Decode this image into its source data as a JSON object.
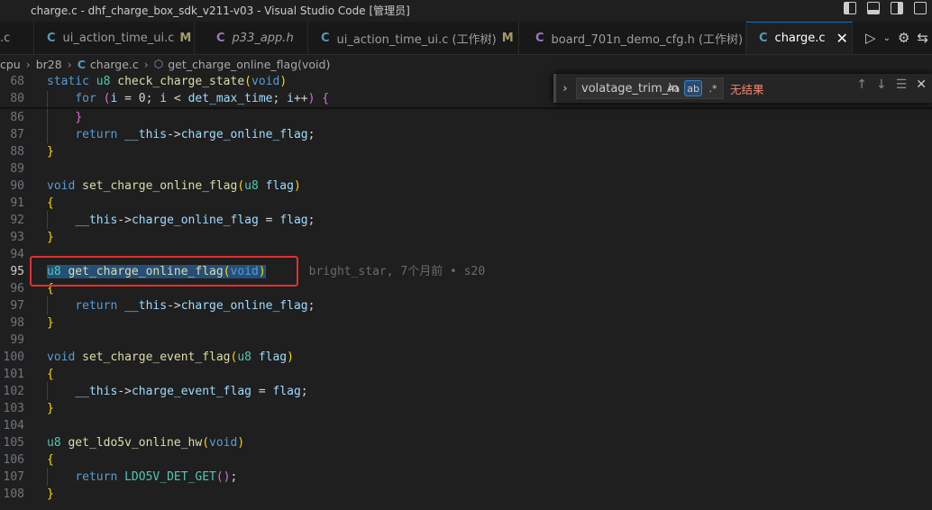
{
  "window": {
    "title": "charge.c - dhf_charge_box_sdk_v211-v03 - Visual Studio Code [管理员]"
  },
  "tabs": [
    {
      "label": ".c",
      "icon": "c-file-icon",
      "modified": "",
      "active": false,
      "italic": false
    },
    {
      "label": "ui_action_time_ui.c",
      "icon": "c-file-icon",
      "modified": "M",
      "active": false,
      "italic": false
    },
    {
      "label": "p33_app.h",
      "icon": "h-file-icon",
      "modified": "",
      "active": false,
      "italic": true
    },
    {
      "label": "ui_action_time_ui.c (工作树)",
      "icon": "c-file-icon",
      "modified": "M",
      "active": false,
      "italic": false
    },
    {
      "label": "board_701n_demo_cfg.h (工作树)",
      "icon": "h-file-icon",
      "modified": "",
      "active": false,
      "italic": false
    },
    {
      "label": "charge.c",
      "icon": "c-file-icon",
      "modified": "",
      "active": true,
      "italic": false
    }
  ],
  "tab_icons": {
    "c": "C",
    "h": "C"
  },
  "breadcrumb": {
    "segments": [
      "cpu",
      "br28",
      "charge.c",
      "get_charge_online_flag(void)"
    ]
  },
  "find": {
    "query": "volatage_trim_in",
    "match_case": "Aa",
    "whole_word": "ab",
    "regex": ".*",
    "result": "无结果"
  },
  "blame": "bright_star, 7个月前 • s20",
  "lines": [
    {
      "num": "68",
      "tokens": [
        [
          "kw",
          "static "
        ],
        [
          "ty",
          "u8 "
        ],
        [
          "fn",
          "check_charge_state"
        ],
        [
          "br1",
          "("
        ],
        [
          "kw",
          "void"
        ],
        [
          "br1",
          ")"
        ]
      ]
    },
    {
      "num": "80",
      "tokens": [
        [
          "plain",
          "    "
        ],
        [
          "kw",
          "for "
        ],
        [
          "br2",
          "("
        ],
        [
          "var",
          "i"
        ],
        [
          "op",
          " = "
        ],
        [
          "plain",
          "0; "
        ],
        [
          "var",
          "i"
        ],
        [
          "op",
          " < "
        ],
        [
          "var",
          "det_max_time"
        ],
        [
          "plain",
          "; "
        ],
        [
          "var",
          "i"
        ],
        [
          "op",
          "++"
        ],
        [
          "br2",
          ")"
        ],
        [
          "plain",
          " "
        ],
        [
          "br2",
          "{"
        ]
      ]
    },
    {
      "num": "86",
      "tokens": [
        [
          "plain",
          "    "
        ],
        [
          "br2",
          "}"
        ]
      ]
    },
    {
      "num": "87",
      "tokens": [
        [
          "plain",
          "    "
        ],
        [
          "kw",
          "return "
        ],
        [
          "var",
          "__this"
        ],
        [
          "op",
          "->"
        ],
        [
          "var",
          "charge_online_flag"
        ],
        [
          "plain",
          ";"
        ]
      ]
    },
    {
      "num": "88",
      "tokens": [
        [
          "br1",
          "}"
        ]
      ]
    },
    {
      "num": "89",
      "tokens": []
    },
    {
      "num": "90",
      "tokens": [
        [
          "kw",
          "void "
        ],
        [
          "fn",
          "set_charge_online_flag"
        ],
        [
          "br1",
          "("
        ],
        [
          "ty",
          "u8 "
        ],
        [
          "var",
          "flag"
        ],
        [
          "br1",
          ")"
        ]
      ]
    },
    {
      "num": "91",
      "tokens": [
        [
          "br1",
          "{"
        ]
      ]
    },
    {
      "num": "92",
      "tokens": [
        [
          "plain",
          "    "
        ],
        [
          "var",
          "__this"
        ],
        [
          "op",
          "->"
        ],
        [
          "var",
          "charge_online_flag"
        ],
        [
          "op",
          " = "
        ],
        [
          "var",
          "flag"
        ],
        [
          "plain",
          ";"
        ]
      ]
    },
    {
      "num": "93",
      "tokens": [
        [
          "br1",
          "}"
        ]
      ]
    },
    {
      "num": "94",
      "tokens": []
    },
    {
      "num": "95",
      "current": true,
      "tokens": [
        [
          "ty",
          "u8 "
        ],
        [
          "fn",
          "get_charge_online_flag"
        ],
        [
          "br1",
          "("
        ],
        [
          "kw",
          "void"
        ],
        [
          "br1",
          ")"
        ]
      ]
    },
    {
      "num": "96",
      "tokens": [
        [
          "br1",
          "{"
        ]
      ]
    },
    {
      "num": "97",
      "tokens": [
        [
          "plain",
          "    "
        ],
        [
          "kw",
          "return "
        ],
        [
          "var",
          "__this"
        ],
        [
          "op",
          "->"
        ],
        [
          "var",
          "charge_online_flag"
        ],
        [
          "plain",
          ";"
        ]
      ]
    },
    {
      "num": "98",
      "tokens": [
        [
          "br1",
          "}"
        ]
      ]
    },
    {
      "num": "99",
      "tokens": []
    },
    {
      "num": "100",
      "tokens": [
        [
          "kw",
          "void "
        ],
        [
          "fn",
          "set_charge_event_flag"
        ],
        [
          "br1",
          "("
        ],
        [
          "ty",
          "u8 "
        ],
        [
          "var",
          "flag"
        ],
        [
          "br1",
          ")"
        ]
      ]
    },
    {
      "num": "101",
      "tokens": [
        [
          "br1",
          "{"
        ]
      ]
    },
    {
      "num": "102",
      "tokens": [
        [
          "plain",
          "    "
        ],
        [
          "var",
          "__this"
        ],
        [
          "op",
          "->"
        ],
        [
          "var",
          "charge_event_flag"
        ],
        [
          "op",
          " = "
        ],
        [
          "var",
          "flag"
        ],
        [
          "plain",
          ";"
        ]
      ]
    },
    {
      "num": "103",
      "tokens": [
        [
          "br1",
          "}"
        ]
      ]
    },
    {
      "num": "104",
      "tokens": []
    },
    {
      "num": "105",
      "tokens": [
        [
          "ty",
          "u8 "
        ],
        [
          "fn",
          "get_ldo5v_online_hw"
        ],
        [
          "br1",
          "("
        ],
        [
          "kw",
          "void"
        ],
        [
          "br1",
          ")"
        ]
      ]
    },
    {
      "num": "106",
      "tokens": [
        [
          "br1",
          "{"
        ]
      ]
    },
    {
      "num": "107",
      "tokens": [
        [
          "plain",
          "    "
        ],
        [
          "kw",
          "return "
        ],
        [
          "ty",
          "LDO5V_DET_GET"
        ],
        [
          "br2",
          "()"
        ],
        [
          "plain",
          ";"
        ]
      ]
    },
    {
      "num": "108",
      "tokens": [
        [
          "br1",
          "}"
        ]
      ]
    }
  ],
  "colors": {
    "keyword": "#569cd6",
    "type": "#4ec9b0",
    "function": "#dcdcaa",
    "variable": "#9cdcfe",
    "annotation_box": "#e22e2e",
    "no_result": "#f48771"
  }
}
